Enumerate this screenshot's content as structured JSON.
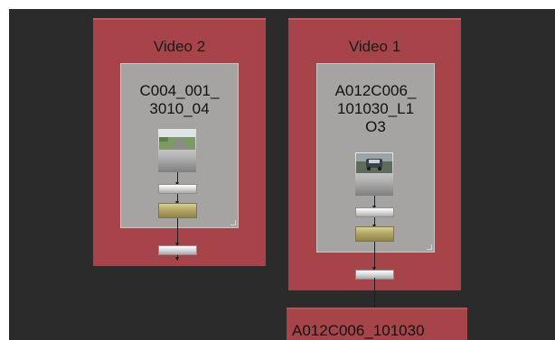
{
  "groups": [
    {
      "title": "Video 2",
      "clip_lines": [
        "C004_001_",
        "3010_04"
      ],
      "thumbnail_icon": "road-landscape-thumbnail-icon"
    },
    {
      "title": "Video 1",
      "clip_lines": [
        "A012C006_",
        "101030_L1",
        "O3"
      ],
      "thumbnail_icon": "car-on-road-thumbnail-icon"
    }
  ],
  "output_node": {
    "label": "A012C006_101030"
  },
  "colors": {
    "canvas_bg": "#2b2b2b",
    "group_bg": "#a74449",
    "card_bg": "#a6a3a3",
    "gold_node": "#b4a766"
  }
}
